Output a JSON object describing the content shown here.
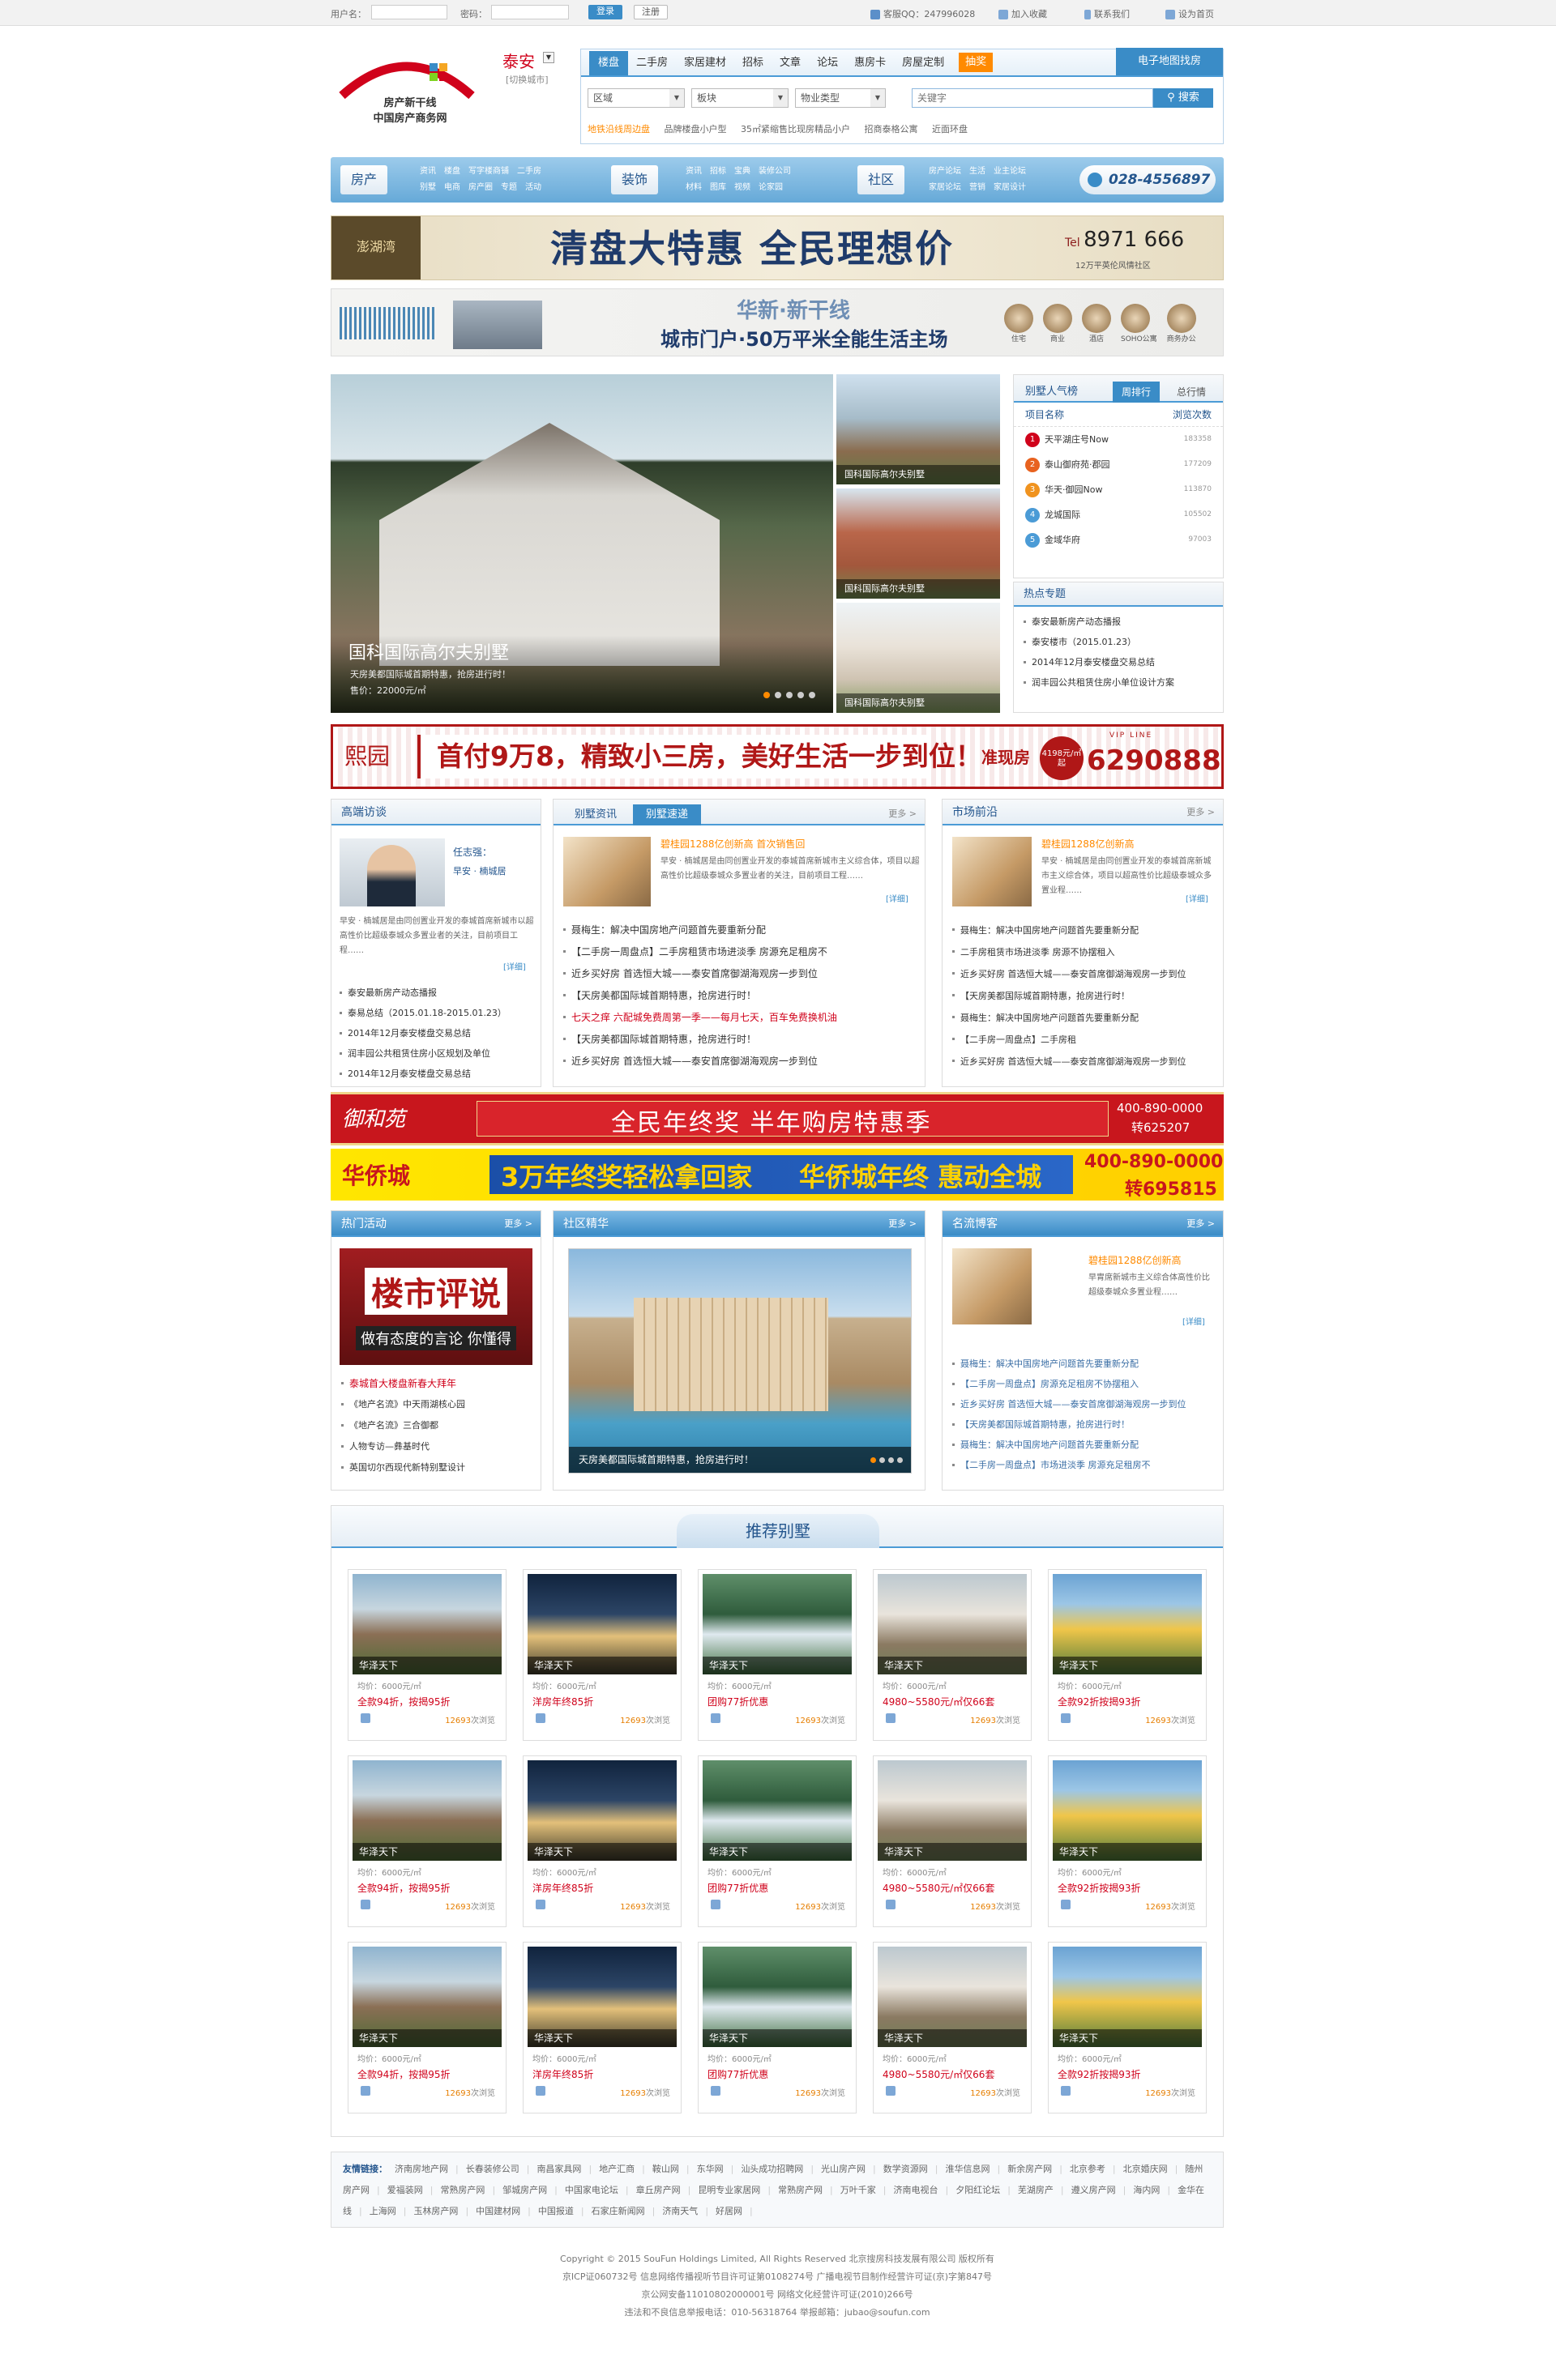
{
  "topbar": {
    "user_label": "用户名：",
    "pass_label": "密码：",
    "login": "登录",
    "register": "注册",
    "service": "客服QQ：247996028",
    "favorite": "加入收藏",
    "contact": "联系我们",
    "homepage": "设为首页"
  },
  "logo": {
    "line1": "房产新干线",
    "line2": "中国房产商务网"
  },
  "city": {
    "name": "泰安",
    "switch": "[切换城市]"
  },
  "nav_tabs": [
    "楼盘",
    "二手房",
    "家居建材",
    "招标",
    "文章",
    "论坛",
    "惠房卡",
    "房屋定制",
    "抽奖"
  ],
  "map_link": "电子地图找房",
  "filters": {
    "area": "区域",
    "block": "板块",
    "type": "物业类型",
    "search_placeholder": "关键字",
    "search_btn": "搜索"
  },
  "hot_links": [
    "地铁沿线周边盘",
    "品牌楼盘小户型",
    "35㎡紧缩售比现房精品小户",
    "招商泰格公寓",
    "近面环盘"
  ],
  "channels": {
    "fangchan": {
      "label": "房产",
      "links": [
        "资讯",
        "楼盘",
        "写字楼商铺",
        "二手房",
        "别墅",
        "电商",
        "房产圈",
        "专题",
        "活动"
      ]
    },
    "zhuangshi": {
      "label": "装饰",
      "links": [
        "资讯",
        "招标",
        "宝典",
        "装修公司",
        "材料",
        "图库",
        "视频",
        "论家园"
      ]
    },
    "shequ": {
      "label": "社区",
      "links": [
        "房产论坛",
        "生活",
        "业主论坛",
        "家居论坛",
        "营销",
        "家居设计"
      ]
    },
    "phone": "028-4556897"
  },
  "banner1": {
    "brand": "澎湖湾",
    "text": "清盘大特惠  全民理想价",
    "tel": "8971 666",
    "sub": "12万平英伦风情社区"
  },
  "banner2": {
    "brand": "华新·新干线",
    "text1": "华新·新干线",
    "text2": "城市门户·50万平米全能生活主场",
    "icons": [
      "住宅",
      "商业",
      "酒店",
      "SOHO公寓",
      "商务办公"
    ]
  },
  "feature": {
    "title": "国科国际高尔夫别墅",
    "desc": "天房美都国际城首期特惠，抢房进行时！",
    "price": "售价：22000元/㎡",
    "thumbs": [
      "国科国际高尔夫别墅",
      "国科国际高尔夫别墅",
      "国科国际高尔夫别墅"
    ]
  },
  "ranking": {
    "title": "别墅人气榜",
    "tab_week": "周排行",
    "tab_total": "总行情",
    "col_name": "项目名称",
    "col_count": "浏览次数",
    "items": [
      {
        "name": "天平湖庄号Now",
        "count": "183358"
      },
      {
        "name": "泰山御府苑·郡园",
        "count": "177209"
      },
      {
        "name": "华天·御园Now",
        "count": "113870"
      },
      {
        "name": "龙城国际",
        "count": "105502"
      },
      {
        "name": "金域华府",
        "count": "97003"
      }
    ]
  },
  "hot_topics": {
    "title": "热点专题",
    "items": [
      "泰安最新房产动态播报",
      "泰安楼市（2015.01.23）",
      "2014年12月泰安楼盘交易总结",
      "润丰园公共租赁住房小单位设计方案"
    ]
  },
  "banner3": {
    "brand": "熙园",
    "text": "首付9万8，精致小三房，美好生活一步到位！",
    "tag": "准现房",
    "price": "4198元/㎡起",
    "vip": "VIP LINE",
    "phone": "6290888"
  },
  "interview": {
    "title": "高端访谈",
    "person": "任志强：",
    "desc_line": "早安 · 楠城居",
    "body": "早安 · 楠城居是由同创置业开发的泰城首席新城市以超高性价比超级泰城众多置业者的关注，目前项目工程……",
    "detail": "[详细]",
    "list": [
      "泰安最新房产动态播报",
      "泰易总结（2015.01.18-2015.01.23）",
      "2014年12月泰安楼盘交易总结",
      "润丰园公共租赁住房小区规划及单位",
      "2014年12月泰安楼盘交易总结"
    ]
  },
  "villa_news": {
    "tab1": "别墅资讯",
    "tab2": "别墅速递",
    "more": "更多 >",
    "headline": "碧桂园1288亿创新高  首次销售回",
    "body": "早安 · 楠城居是由同创置业开发的泰城首席新城市主义综合体，项目以超高性价比超级泰城众多置业者的关注，目前项目工程……",
    "detail": "[详细]",
    "list": [
      {
        "t": "聂梅生：解决中国房地产问题首先要重新分配",
        "red": false
      },
      {
        "t": "【二手房一周盘点】二手房租赁市场进淡季 房源充足租房不",
        "red": false
      },
      {
        "t": "近乡买好房 首选恒大城——泰安首席御湖海观房一步到位",
        "red": false
      },
      {
        "t": "【天房美都国际城首期特惠，抢房进行时！",
        "red": false
      },
      {
        "t": "七天之痒 六配城免费周第一季——每月七天，百车免费换机油",
        "red": true
      },
      {
        "t": "【天房美都国际城首期特惠，抢房进行时！",
        "red": false
      },
      {
        "t": "近乡买好房 首选恒大城——泰安首席御湖海观房一步到位",
        "red": false
      }
    ]
  },
  "market": {
    "title": "市场前沿",
    "more": "更多 >",
    "headline": "碧桂园1288亿创新高",
    "body": "早安 · 楠城居是由同创置业开发的泰城首席新城市主义综合体，项目以超高性价比超级泰城众多置业程……",
    "detail": "[详细]",
    "list": [
      "聂梅生：解决中国房地产问题首先要重新分配",
      "二手房租赁市场进淡季 房源不协摆租入",
      "近乡买好房 首选恒大城——泰安首席御湖海观房一步到位",
      "【天房美都国际城首期特惠，抢房进行时！",
      "聂梅生：解决中国房地产问题首先要重新分配",
      "【二手房一周盘点】二手房租",
      "近乡买好房 首选恒大城——泰安首席御湖海观房一步到位"
    ]
  },
  "banner4": {
    "brand": "御和苑",
    "text": "全民年终奖  半年购房特惠季",
    "phone1": "400-890-0000",
    "phone2": "转625207"
  },
  "banner5": {
    "brand": "华侨城",
    "text1": "3万年终奖轻松拿回家",
    "text2": "华侨城年终  惠动全城",
    "phone1": "400-890-0000",
    "phone2": "转695815"
  },
  "activities": {
    "title": "热门活动",
    "more": "更多 >",
    "poster1": "楼市评说",
    "poster2": "做有态度的言论 你懂得",
    "list": [
      {
        "t": "泰城首大楼盘新春大拜年",
        "red": true
      },
      {
        "t": "《地产名流》中天雨湖核心园",
        "red": false
      },
      {
        "t": "《地产名流》三合御都",
        "red": false
      },
      {
        "t": "人物专访—彝基时代",
        "red": false
      },
      {
        "t": "英国切尔西现代新特别墅设计",
        "red": false
      }
    ]
  },
  "community": {
    "title": "社区精华",
    "more": "更多 >",
    "caption": "天房美都国际城首期特惠，抢房进行时！"
  },
  "blog": {
    "title": "名流博客",
    "more": "更多 >",
    "headline": "碧桂园1288亿创新高",
    "body": "早胄席新城市主义综合体高性价比超级泰城众多置业程……",
    "detail": "[详细]",
    "list": [
      "聂梅生：解决中国房地产问题首先要重新分配",
      "【二手房一周盘点】房源充足租房不协摆租入",
      "近乡买好房 首选恒大城——泰安首席御湖海观房一步到位",
      "【天房美都国际城首期特惠，抢房进行时！",
      "聂梅生：解决中国房地产问题首先要重新分配",
      "【二手房一周盘点】市场进淡季 房源充足租房不"
    ]
  },
  "recommend": {
    "title": "推荐别墅",
    "cards": [
      {
        "name": "华泽天下",
        "price": "均价：6000元/㎡",
        "promo": "全款94折，按揭95折",
        "views": "12693",
        "suffix": "次浏览"
      },
      {
        "name": "华泽天下",
        "price": "均价：6000元/㎡",
        "promo": "洋房年终85折",
        "views": "12693",
        "suffix": "次浏览"
      },
      {
        "name": "华泽天下",
        "price": "均价：6000元/㎡",
        "promo": "团购77折优惠",
        "views": "12693",
        "suffix": "次浏览"
      },
      {
        "name": "华泽天下",
        "price": "均价：6000元/㎡",
        "promo": "4980~5580元/㎡仅66套",
        "views": "12693",
        "suffix": "次浏览"
      },
      {
        "name": "华泽天下",
        "price": "均价：6000元/㎡",
        "promo": "全款92折按揭93折",
        "views": "12693",
        "suffix": "次浏览"
      }
    ]
  },
  "friends": {
    "title": "友情链接：",
    "links": [
      "济南房地产网",
      "长春装修公司",
      "南昌家具网",
      "地产汇商",
      "鞍山网",
      "东华网",
      "汕头成功招聘网",
      "光山房产网",
      "数学资源网",
      "淮华信息网",
      "新余房产网",
      "北京参考",
      "北京婚庆网",
      "随州房产网",
      "爱福装网",
      "常熟房产网",
      "邹城房产网",
      "中国家电论坛",
      "章丘房产网",
      "昆明专业家居网",
      "常熟房产网",
      "万叶千家",
      "济南电视台",
      "夕阳红论坛",
      "芜湖房产",
      "遵义房产网",
      "海内网",
      "金华在线",
      "上海网",
      "玉林房产网",
      "中国建材网",
      "中国报道",
      "石家庄新闻网",
      "济南天气",
      "好居网"
    ]
  },
  "footer": {
    "l1": "Copyright © 2015 SouFun Holdings Limited, All Rights Reserved 北京搜房科技发展有限公司 版权所有",
    "l2": "京ICP证060732号 信息网络传播视听节目许可证第0108274号 广播电视节目制作经营许可证(京)字第847号",
    "l3": "京公网安备11010802000001号 网络文化经营许可证(2010)266号",
    "l4": "违法和不良信息举报电话：010-56318764 举报邮箱：jubao@soufun.com"
  },
  "colors": {
    "brand_blue": "#3a8cc7",
    "accent_red": "#d0021b",
    "accent_orange": "#ff8a00"
  }
}
